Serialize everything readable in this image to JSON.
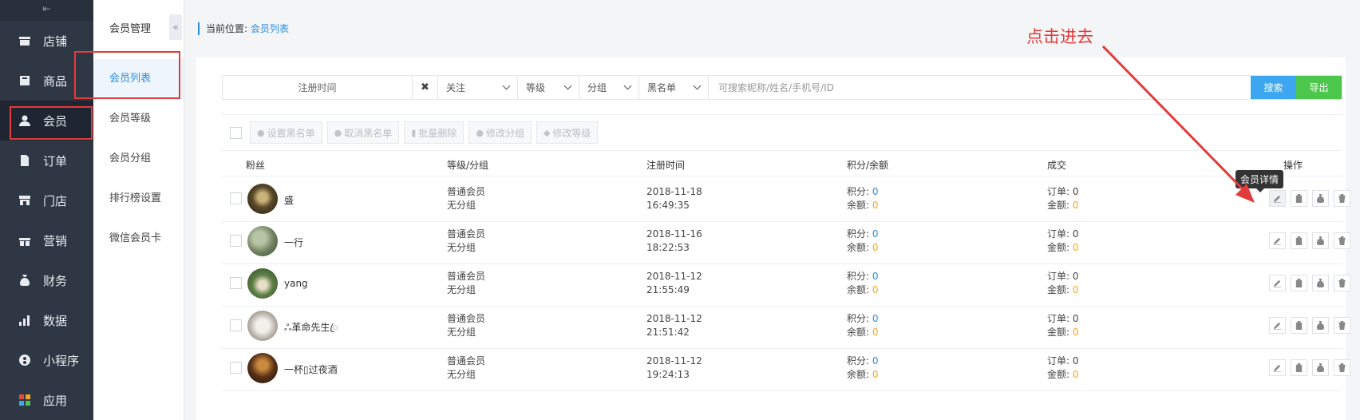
{
  "nav": {
    "collapse_icon": "⇤",
    "items": [
      {
        "label": "店铺",
        "icon": "store-icon"
      },
      {
        "label": "商品",
        "icon": "goods-icon"
      },
      {
        "label": "会员",
        "icon": "user-icon"
      },
      {
        "label": "订单",
        "icon": "order-icon"
      },
      {
        "label": "门店",
        "icon": "shop-icon"
      },
      {
        "label": "营销",
        "icon": "gift-icon"
      },
      {
        "label": "财务",
        "icon": "money-bag-icon"
      },
      {
        "label": "数据",
        "icon": "bar-chart-icon"
      },
      {
        "label": "小程序",
        "icon": "mini-program-icon"
      },
      {
        "label": "应用",
        "icon": "apps-icon"
      }
    ]
  },
  "submenu": {
    "title": "会员管理",
    "items": [
      "会员列表",
      "会员等级",
      "会员分组",
      "排行榜设置",
      "微信会员卡"
    ],
    "collapse": "«"
  },
  "breadcrumb": {
    "prefix": "当前位置:",
    "current": "会员列表"
  },
  "filters": {
    "date": "注册时间",
    "clear": "✖",
    "follow": "关注",
    "level": "等级",
    "group": "分组",
    "blacklist": "黑名单",
    "search_placeholder": "可搜索昵称/姓名/手机号/ID",
    "search_btn": "搜索",
    "export_btn": "导出"
  },
  "batch": {
    "set_blacklist": "设置黑名单",
    "unset_blacklist": "取消黑名单",
    "batch_delete": "批量删除",
    "edit_group": "修改分组",
    "edit_level": "修改等级"
  },
  "table": {
    "headers": [
      "粉丝",
      "等级/分组",
      "注册时间",
      "积分/余额",
      "成交",
      "操作"
    ],
    "points_label": "积分:",
    "balance_label": "余额:",
    "orders_label": "订单:",
    "amount_label": "金额:",
    "rows": [
      {
        "name": "盛",
        "level": "普通会员",
        "group": "无分组",
        "date": "2018-11-18",
        "time": "16:49:35",
        "points": "0",
        "balance": "0",
        "orders": "0",
        "amount": "0"
      },
      {
        "name": "一行",
        "level": "普通会员",
        "group": "无分组",
        "date": "2018-11-16",
        "time": "18:22:53",
        "points": "0",
        "balance": "0",
        "orders": "0",
        "amount": "0"
      },
      {
        "name": "yang",
        "level": "普通会员",
        "group": "无分组",
        "date": "2018-11-12",
        "time": "21:55:49",
        "points": "0",
        "balance": "0",
        "orders": "0",
        "amount": "0"
      },
      {
        "name": "ஃ革命先生ꦿ",
        "level": "普通会员",
        "group": "无分组",
        "date": "2018-11-12",
        "time": "21:51:42",
        "points": "0",
        "balance": "0",
        "orders": "0",
        "amount": "0"
      },
      {
        "name": "一杯▯过夜酒",
        "level": "普通会员",
        "group": "无分组",
        "date": "2018-11-12",
        "time": "19:24:13",
        "points": "0",
        "balance": "0",
        "orders": "0",
        "amount": "0"
      }
    ]
  },
  "tooltip": "会员详情",
  "annotation": "点击进去",
  "colors": {
    "accent": "#2c8dde",
    "annotation": "#e23b3b",
    "nav_bg": "#2f3744",
    "orange": "#f5a623",
    "export": "#4cc74c"
  }
}
